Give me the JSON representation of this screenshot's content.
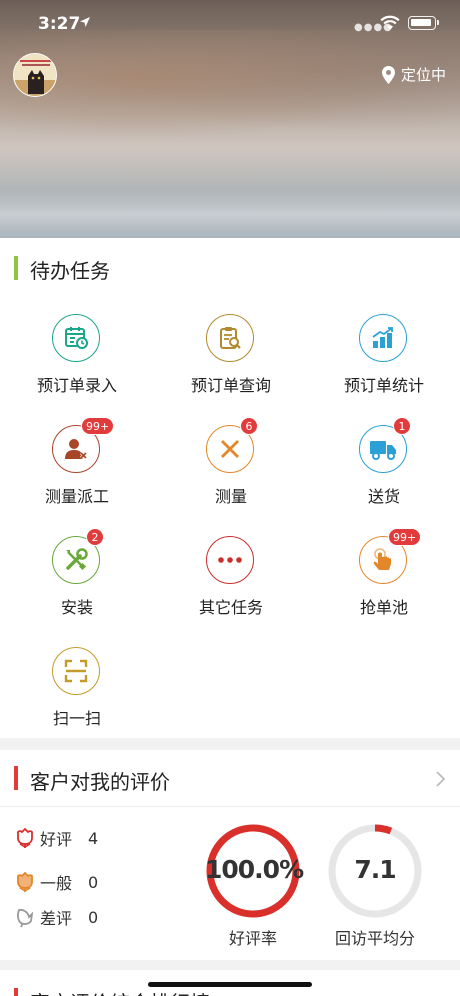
{
  "status_bar": {
    "time": "3:27"
  },
  "header": {
    "location_label": "定位中"
  },
  "todo": {
    "title": "待办任务",
    "accent": "#8cc63f",
    "items": [
      {
        "label": "预订单录入",
        "icon": "form-entry-icon",
        "color": "#1aa68a",
        "badge": ""
      },
      {
        "label": "预订单查询",
        "icon": "clipboard-search-icon",
        "color": "#b08a2e",
        "badge": ""
      },
      {
        "label": "预订单统计",
        "icon": "chart-up-icon",
        "color": "#2aa0d6",
        "badge": ""
      },
      {
        "label": "测量派工",
        "icon": "person-dispatch-icon",
        "color": "#a8462a",
        "badge": "99+"
      },
      {
        "label": "测量",
        "icon": "cross-tools-icon",
        "color": "#e3872b",
        "badge": "6"
      },
      {
        "label": "送货",
        "icon": "truck-icon",
        "color": "#2aa0d6",
        "badge": "1"
      },
      {
        "label": "安装",
        "icon": "wrench-screwdriver-icon",
        "color": "#6aa83a",
        "badge": "2"
      },
      {
        "label": "其它任务",
        "icon": "more-dots-icon",
        "color": "#c9302c",
        "badge": ""
      },
      {
        "label": "抢单池",
        "icon": "tap-hand-icon",
        "color": "#e3872b",
        "badge": "99+"
      },
      {
        "label": "扫一扫",
        "icon": "scan-icon",
        "color": "#c49a2c",
        "badge": ""
      }
    ]
  },
  "reviews": {
    "title": "客户对我的评价",
    "accent": "#e03a3a",
    "rows": [
      {
        "label": "好评",
        "count": "4",
        "icon": "flower-good-icon",
        "color": "#d9302c"
      },
      {
        "label": "一般",
        "count": "0",
        "icon": "flower-normal-icon",
        "color": "#e3872b"
      },
      {
        "label": "差评",
        "count": "0",
        "icon": "flower-bad-icon",
        "color": "#999999"
      }
    ],
    "good_rate": {
      "value": "100.0%",
      "label": "好评率",
      "fraction": 1.0,
      "color": "#d9302c"
    },
    "avg_score": {
      "value": "7.1",
      "label": "回访平均分",
      "fraction": 0.06,
      "color": "#d9302c"
    }
  },
  "ranking": {
    "title": "客户评价综合排行榜",
    "accent": "#e03a3a"
  }
}
